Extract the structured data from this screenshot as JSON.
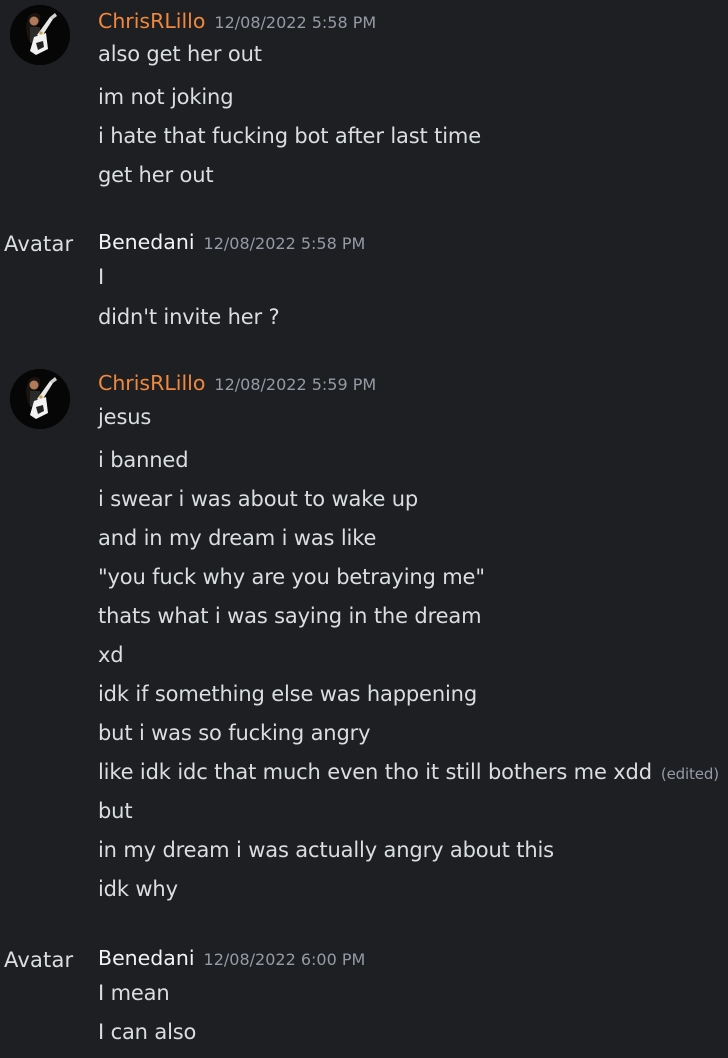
{
  "messages": [
    {
      "author": "ChrisRLillo",
      "author_color": "#f0883e",
      "avatar": "guitarist-photo",
      "timestamp": "12/08/2022 5:58 PM",
      "lines": [
        "also get her out",
        "im not joking",
        "i hate that fucking bot after last time",
        "get her out"
      ]
    },
    {
      "author": "Benedani",
      "author_color": "#f2f3f5",
      "avatar": "Avatar",
      "timestamp": "12/08/2022 5:58 PM",
      "lines": [
        "I",
        "didn't invite her ?"
      ]
    },
    {
      "author": "ChrisRLillo",
      "author_color": "#f0883e",
      "avatar": "guitarist-photo",
      "timestamp": "12/08/2022 5:59 PM",
      "lines": [
        "jesus",
        "i banned",
        "i swear i was about to wake up",
        "and in my dream i was like",
        "\"you fuck why are you betraying me\"",
        "thats what i was saying in the dream",
        "xd",
        "idk if something else was happening",
        "but i was so fucking angry",
        "like idk idc that much even tho it still bothers me xdd",
        "but",
        "in my dream i was actually angry about this",
        "idk why"
      ],
      "edited_label": "(edited)"
    },
    {
      "author": "Benedani",
      "author_color": "#f2f3f5",
      "avatar": "Avatar",
      "timestamp": "12/08/2022 6:00 PM",
      "lines": [
        "I mean",
        "I can also"
      ]
    }
  ]
}
